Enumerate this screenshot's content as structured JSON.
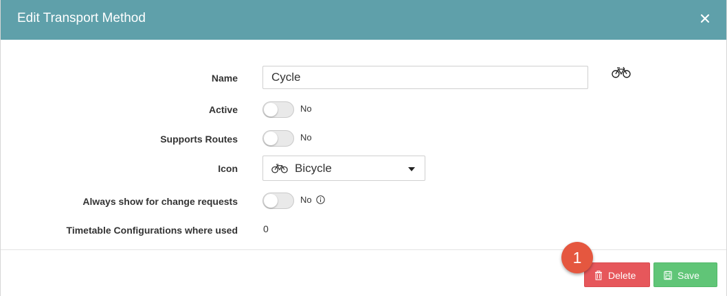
{
  "dialog": {
    "title": "Edit Transport Method",
    "close_icon": "close-icon"
  },
  "form": {
    "name": {
      "label": "Name",
      "value": "Cycle",
      "preview_icon": "bicycle-icon"
    },
    "active": {
      "label": "Active",
      "state": "No",
      "on": false
    },
    "supports_routes": {
      "label": "Supports Routes",
      "state": "No",
      "on": false
    },
    "icon": {
      "label": "Icon",
      "selected": "Bicycle",
      "selected_icon": "bicycle-icon"
    },
    "always_show": {
      "label": "Always show for change requests",
      "state": "No",
      "on": false,
      "info_icon": "info-icon"
    },
    "timetable_configs": {
      "label": "Timetable Configurations where used",
      "value": "0"
    }
  },
  "footer": {
    "step_badge": "1",
    "delete_label": "Delete",
    "delete_icon": "trash-icon",
    "save_label": "Save",
    "save_icon": "save-icon"
  },
  "colors": {
    "header": "#5fa0aa",
    "delete": "#e6575b",
    "save": "#60c577",
    "badge": "#e5573f"
  }
}
